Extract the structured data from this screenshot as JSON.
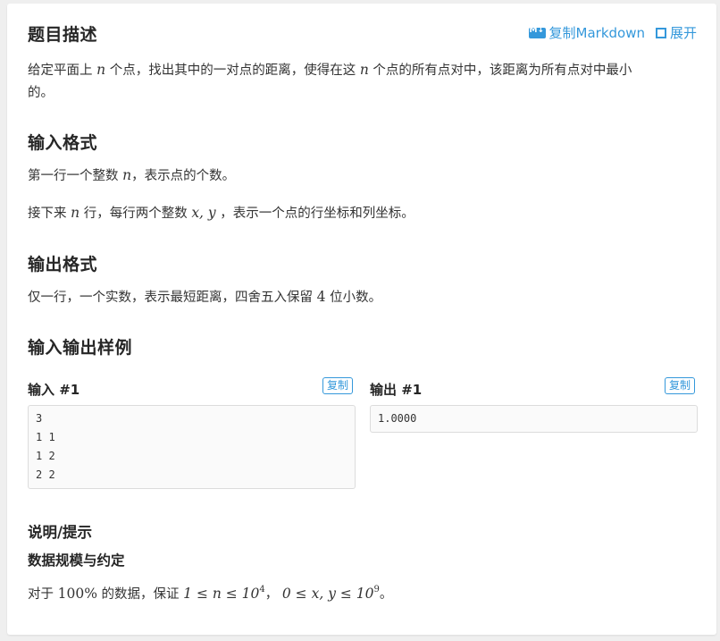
{
  "header": {
    "title": "题目描述",
    "copy_markdown": "复制Markdown",
    "expand": "展开"
  },
  "description": {
    "line1_a": "给定平面上",
    "var_n": "n",
    "line1_b": "个点，找出其中的一对点的距离，使得在这",
    "line1_c": "个点的所有点对中，该距离为所有点对中最小",
    "line2": "的。"
  },
  "input_format": {
    "title": "输入格式",
    "p1_a": "第一行一个整数",
    "p1_b": "，表示点的个数。",
    "p2_a": "接下来",
    "p2_b": "行，每行两个整数",
    "p2_vars": "x, y",
    "p2_c": "，表示一个点的行坐标和列坐标。"
  },
  "output_format": {
    "title": "输出格式",
    "p1_a": "仅一行，一个实数，表示最短距离，四舍五入保留",
    "p1_num": "4",
    "p1_b": "位小数。"
  },
  "samples": {
    "title": "输入输出样例",
    "input_label": "输入 #1",
    "output_label": "输出 #1",
    "copy_label": "复制",
    "input_lines": [
      "3",
      "1 1",
      "1 2",
      "2 2"
    ],
    "output_lines": [
      "1.0000"
    ]
  },
  "hint": {
    "title": "说明/提示",
    "subtitle": "数据规模与约定",
    "p_a": "对于",
    "p_pct": "100%",
    "p_b": "的数据，保证",
    "p_expr1": "1 ≤ n ≤ 10",
    "p_exp1": "4",
    "p_sep": "，",
    "p_expr2": "0 ≤ x, y ≤ 10",
    "p_exp2": "9",
    "p_end": "。"
  }
}
